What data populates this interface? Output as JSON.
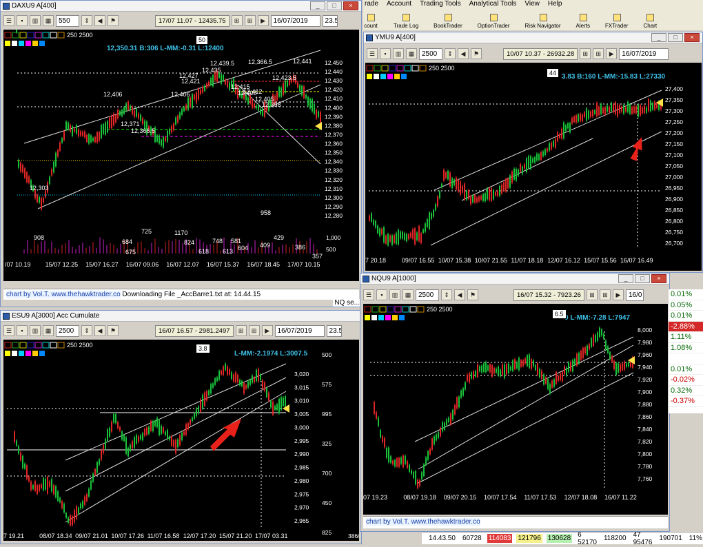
{
  "app_menu": [
    "rade",
    "Account",
    "Trading Tools",
    "Analytical Tools",
    "View",
    "Help"
  ],
  "app_toolbar": [
    "count",
    "Trade Log",
    "BookTrader",
    "OptionTrader",
    "Risk Navigator",
    "Alerts",
    "FXTrader",
    "Chart"
  ],
  "windows": {
    "dax": {
      "title": "DAXU9 A[400]",
      "size_field": "550",
      "hist_field": "17/07 11.07 - 12435.75",
      "date_field": "16/07/2019",
      "date_next": "23.5",
      "overlay": "50",
      "caption": "12,350.31 B:306 L-MM:-0.31 L:12400",
      "sizes": [
        "250",
        "2500"
      ],
      "yaxis": [
        "12,450",
        "12,440",
        "12,430",
        "12,420",
        "12,410",
        "12,400",
        "12,390",
        "12,380",
        "12,370",
        "12,360",
        "12,350",
        "12,340",
        "12,330",
        "12,320",
        "12,310",
        "12,300",
        "12,290",
        "12,280",
        "1,000",
        "500"
      ],
      "xaxis": [
        "/07 10.19",
        "15/07 12.25",
        "15/07 16.27",
        "16/07 09.06",
        "16/07 12.07",
        "16/07 15.37",
        "16/07 18.45",
        "17/07 10.15"
      ],
      "price_labels": [
        "12,406",
        "12,427",
        "12,421",
        "12,406",
        "12,371",
        "12,366.5",
        "12,366.5",
        "12,303",
        "12,435",
        "12,439.5",
        "12,441",
        "12,423.5",
        "12,415",
        "12,408",
        "12,412",
        "12,405",
        "12,398"
      ],
      "volume_labels": [
        "908",
        "725",
        "684",
        "675",
        "1170",
        "824",
        "748",
        "581",
        "604",
        "618",
        "429",
        "958",
        "409",
        "386",
        "357",
        "613"
      ]
    },
    "ymu": {
      "title": "YMU9 A[400]",
      "size_field": "2500",
      "hist_field": "10/07 10.37 - 26932.28",
      "date_field": "16/07/2019",
      "overlay": "44",
      "caption": "3.83 B:160 L-MM:-15.83 L:27330",
      "sizes": [
        "250",
        "2500"
      ],
      "yaxis": [
        "27,400",
        "27,350",
        "27,300",
        "27,250",
        "27,200",
        "27,150",
        "27,100",
        "27,050",
        "27,000",
        "26,950",
        "26,900",
        "26,850",
        "26,800",
        "26,750",
        "26,700"
      ],
      "xaxis": [
        "7 20.18",
        "09/07 16.55",
        "10/07 15.38",
        "10/07 21.55",
        "11/07 18.18",
        "12/07 16.12",
        "15/07 15.56",
        "16/07 16.49"
      ]
    },
    "esu": {
      "title": "ESU9 A[3000] Acc Cumulate",
      "size_field": "2500",
      "hist_field": "16/07 16.57 - 2981.2497",
      "date_field": "16/07/2019",
      "date_next": "23.5",
      "overlay": "3.8",
      "caption": "L-MM:-2.1974 L:3007.5",
      "sizes": [
        "250",
        "2500"
      ],
      "left_axis": [
        "500",
        "575",
        "995",
        "325",
        "700",
        "450",
        "825"
      ],
      "yaxis": [
        "3,020",
        "3,015",
        "3,010",
        "3,005",
        "3,000",
        "2,995",
        "2,990",
        "2,985",
        "2,980",
        "2,975",
        "2,970",
        "2,965"
      ],
      "xaxis": [
        "7 19.21",
        "08/07 18.34",
        "09/07 21.01",
        "10/07 17.26",
        "11/07 16.58",
        "12/07 17.20",
        "15/07 21.20",
        "17/07 03.31"
      ],
      "footer": "386/200"
    },
    "nqu": {
      "title": "NQU9 A[1000]",
      "size_field": "2500",
      "hist_field": "16/07 15.32 - 7923.26",
      "date_field": "16/0",
      "overlay": "6.5",
      "caption": "0 L-MM:-7.28 L:7947",
      "sizes": [
        "250",
        "2500"
      ],
      "yaxis": [
        "8,000",
        "7,980",
        "7,960",
        "7,940",
        "7,920",
        "7,900",
        "7,880",
        "7,860",
        "7,840",
        "7,820",
        "7,800",
        "7,780",
        "7,760"
      ],
      "xaxis": [
        "07 19.23",
        "08/07 19.18",
        "09/07 20.15",
        "10/07 17.54",
        "11/07 17.53",
        "12/07 18.08",
        "16/07 11.22"
      ]
    }
  },
  "status": {
    "credit": "chart by Vol.T. www.thehawktrader.co",
    "download": "Downloading File _AccBarre1.txt at: 14.44.15",
    "nqtab": "NQ se..."
  },
  "right_panel": [
    "0.01%",
    "0.05%",
    "0.01%",
    "-2.88%",
    "1.11%",
    "1.08%",
    "",
    "0.01%",
    "-0.02%",
    "0.32%",
    "-0.37%"
  ],
  "bottom_row": [
    "14.43.50",
    "60728",
    "114083",
    "121796",
    "130628",
    "6 52170",
    "118200",
    "47 95476",
    "190701",
    "11%"
  ],
  "colors": {
    "accent": "#3fc1e8",
    "up": "#19c23a",
    "down": "#e02626",
    "arrow": "#e8221a"
  }
}
